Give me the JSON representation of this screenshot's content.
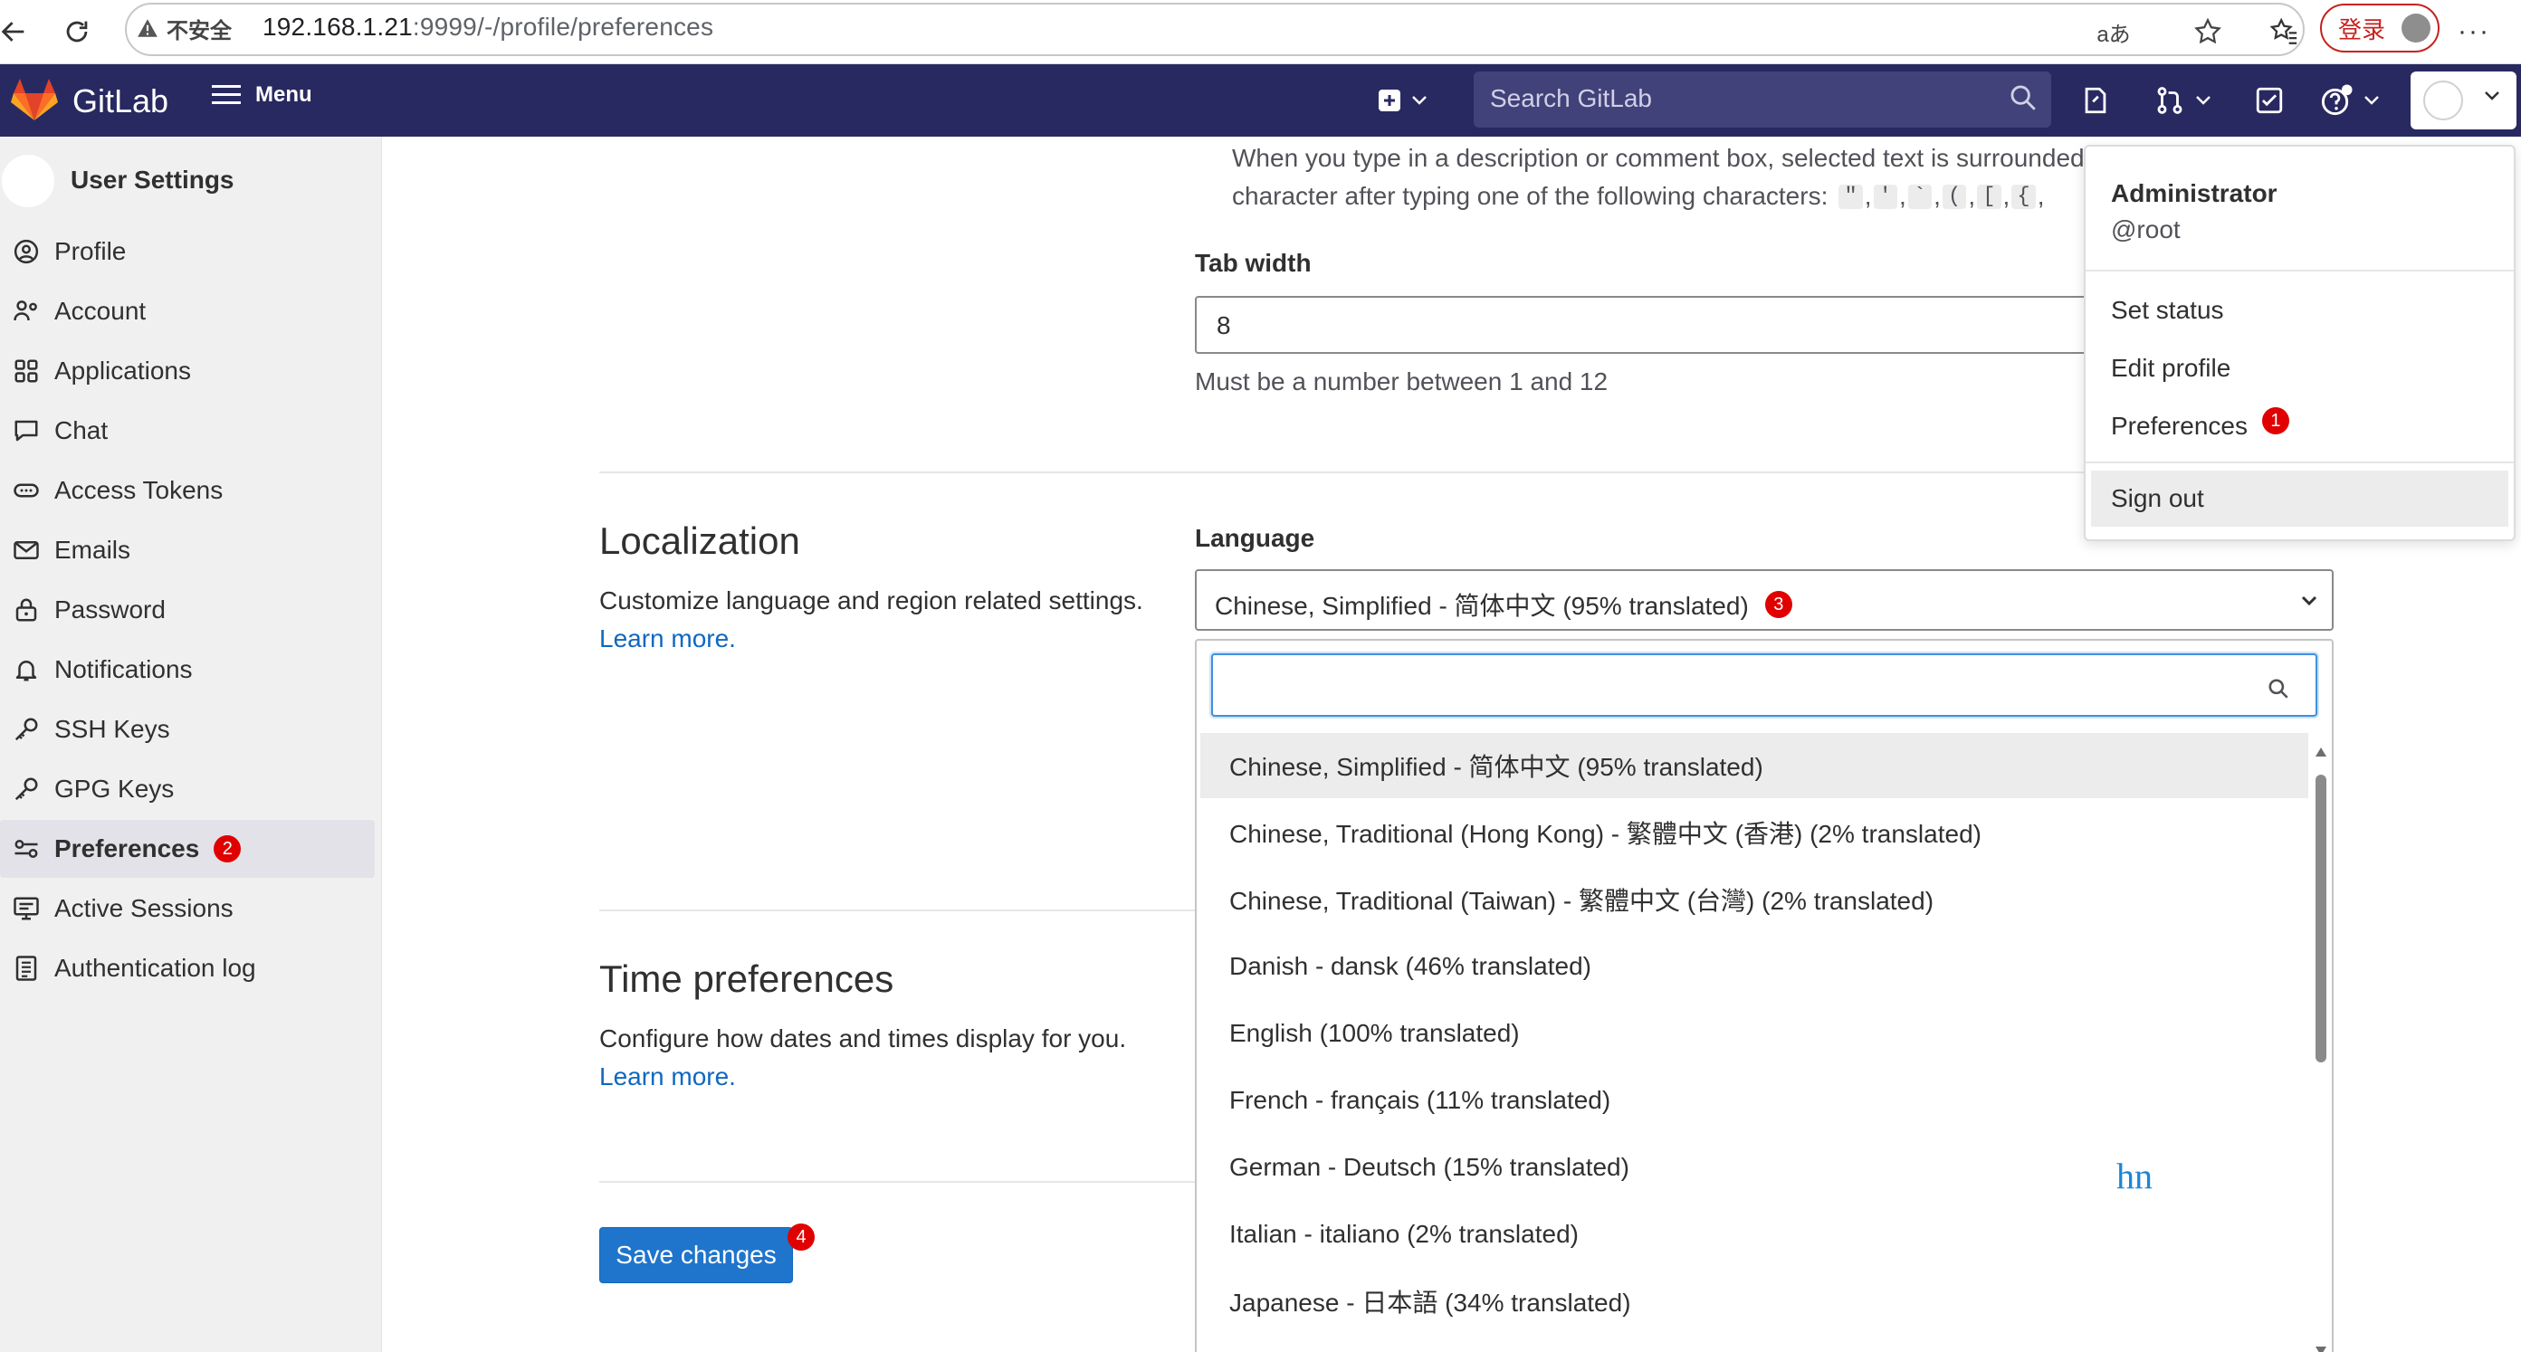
{
  "browser": {
    "insecure_label": "不安全",
    "url_host": "192.168.1.21",
    "url_rest": ":9999/-/profile/preferences",
    "login_label": "登录"
  },
  "header": {
    "brand": "GitLab",
    "menu_label": "Menu",
    "search_placeholder": "Search GitLab"
  },
  "sidebar": {
    "title": "User Settings",
    "items": [
      {
        "label": "Profile",
        "icon": "profile-icon"
      },
      {
        "label": "Account",
        "icon": "account-icon"
      },
      {
        "label": "Applications",
        "icon": "applications-icon"
      },
      {
        "label": "Chat",
        "icon": "chat-icon"
      },
      {
        "label": "Access Tokens",
        "icon": "token-icon"
      },
      {
        "label": "Emails",
        "icon": "mail-icon"
      },
      {
        "label": "Password",
        "icon": "lock-icon"
      },
      {
        "label": "Notifications",
        "icon": "bell-icon"
      },
      {
        "label": "SSH Keys",
        "icon": "key-icon"
      },
      {
        "label": "GPG Keys",
        "icon": "key-icon"
      },
      {
        "label": "Preferences",
        "icon": "preferences-icon",
        "active": true,
        "badge": "2"
      },
      {
        "label": "Active Sessions",
        "icon": "monitor-icon"
      },
      {
        "label": "Authentication log",
        "icon": "log-icon"
      }
    ]
  },
  "behavior": {
    "desc_line1": "When you type in a description or comment box, selected text is surrounded",
    "desc_line2_prefix": "character after typing one of the following characters:",
    "chars": [
      "\"",
      "'",
      "`",
      "(",
      "[",
      "{"
    ],
    "tab_width_label": "Tab width",
    "tab_width_value": "8",
    "tab_width_help": "Must be a number between 1 and 12"
  },
  "localization": {
    "title": "Localization",
    "description": "Customize language and region related settings.",
    "learn_more": "Learn more.",
    "language_label": "Language",
    "selected_language": "Chinese, Simplified - 简体中文 (95% translated)",
    "selected_badge": "3",
    "options": [
      "Chinese, Simplified - 简体中文 (95% translated)",
      "Chinese, Traditional (Hong Kong) - 繁體中文 (香港) (2% translated)",
      "Chinese, Traditional (Taiwan) - 繁體中文 (台灣) (2% translated)",
      "Danish - dansk (46% translated)",
      "English (100% translated)",
      "French - français (11% translated)",
      "German - Deutsch (15% translated)",
      "Italian - italiano (2% translated)",
      "Japanese - 日本語 (34% translated)"
    ]
  },
  "time_prefs": {
    "title": "Time preferences",
    "description": "Configure how dates and times display for you.",
    "learn_more": "Learn more."
  },
  "save": {
    "label": "Save changes",
    "badge": "4"
  },
  "user_menu": {
    "name": "Administrator",
    "handle": "@root",
    "items": [
      "Set status",
      "Edit profile",
      "Preferences",
      "Sign out"
    ],
    "preferences_badge": "1"
  },
  "watermark": "hn",
  "colors": {
    "header_bg": "#292961",
    "link": "#1068bf",
    "primary": "#1f75cb",
    "badge": "#e00000"
  }
}
